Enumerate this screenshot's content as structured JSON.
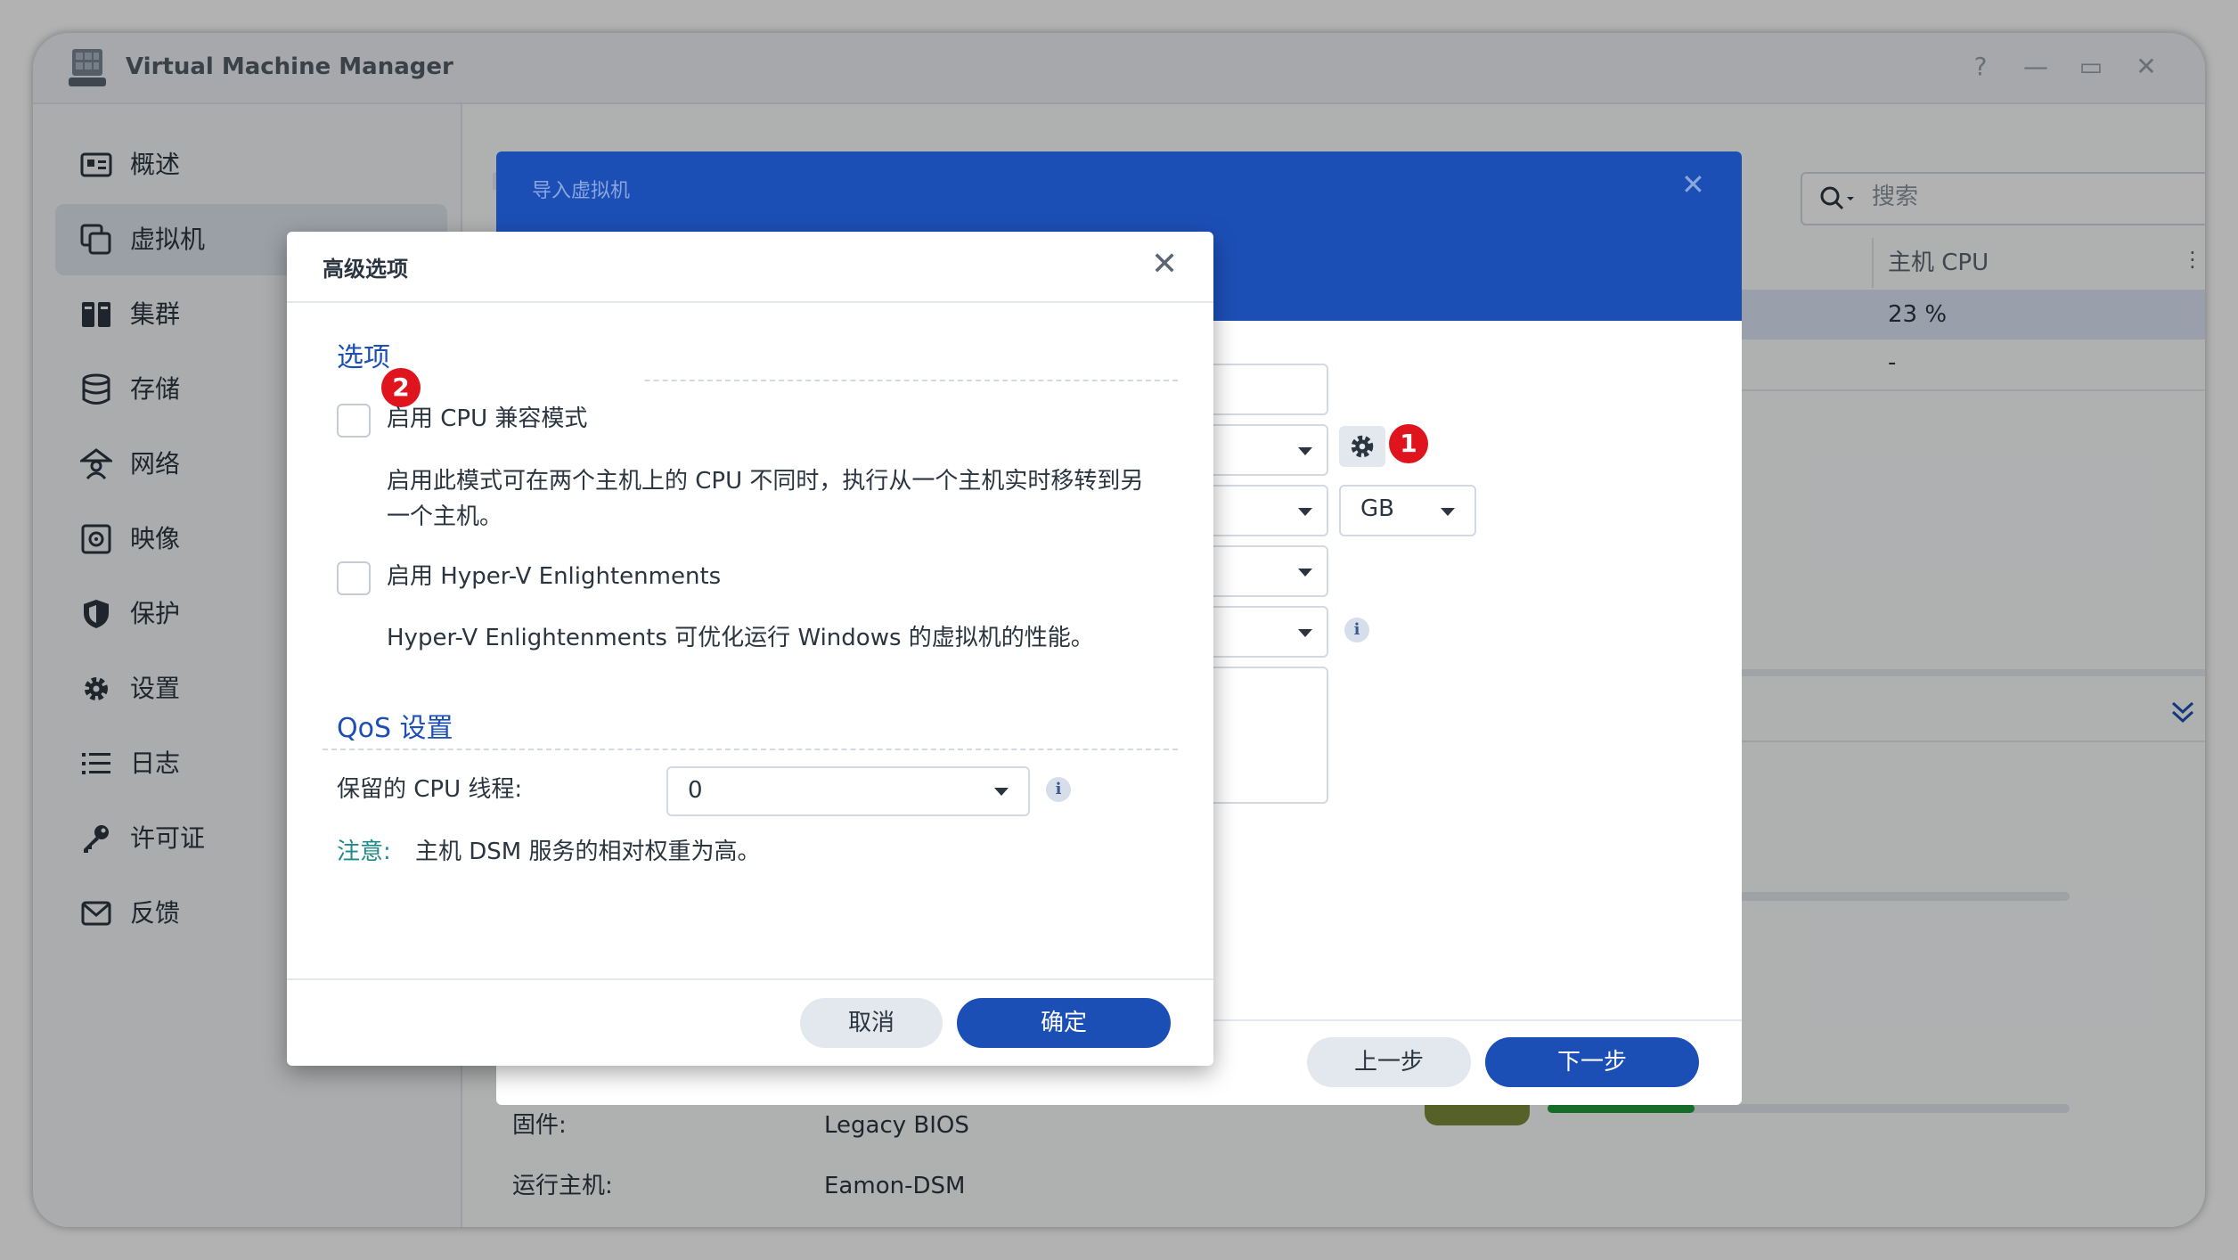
{
  "window": {
    "title": "Virtual Machine Manager",
    "controls": {
      "help": "?",
      "minimize": "—",
      "maximize": "▭",
      "close": "✕"
    }
  },
  "sidebar": {
    "items": [
      {
        "label": "概述",
        "icon": "overview-icon",
        "active": false
      },
      {
        "label": "虚拟机",
        "icon": "virtual-machine-icon",
        "active": true
      },
      {
        "label": "集群",
        "icon": "cluster-icon",
        "active": false
      },
      {
        "label": "存储",
        "icon": "storage-icon",
        "active": false
      },
      {
        "label": "网络",
        "icon": "network-icon",
        "active": false
      },
      {
        "label": "映像",
        "icon": "image-icon",
        "active": false
      },
      {
        "label": "保护",
        "icon": "shield-icon",
        "active": false
      },
      {
        "label": "设置",
        "icon": "gear-icon",
        "active": false
      },
      {
        "label": "日志",
        "icon": "log-list-icon",
        "active": false
      },
      {
        "label": "许可证",
        "icon": "key-icon",
        "active": false
      },
      {
        "label": "反馈",
        "icon": "mail-icon",
        "active": false
      }
    ]
  },
  "main": {
    "search_placeholder": "搜索",
    "table": {
      "column_cpu": "主机 CPU",
      "rows": [
        {
          "cpu": "23 %"
        },
        {
          "cpu": "-"
        }
      ]
    },
    "details": {
      "firmware_label": "固件:",
      "firmware_value": "Legacy BIOS",
      "host_label": "运行主机:",
      "host_value": "Eamon-DSM"
    }
  },
  "wizard": {
    "title": "导入虚拟机",
    "unit_select": "GB",
    "prev_button": "上一步",
    "next_button": "下一步"
  },
  "advanced_dialog": {
    "title": "高级选项",
    "options_section": "选项",
    "cpu_compat_label": "启用 CPU 兼容模式",
    "cpu_compat_desc_line1": "启用此模式可在两个主机上的 CPU 不同时，执行从一个主机实时移转到另",
    "cpu_compat_desc_line2": "一个主机。",
    "hyperv_label": "启用 Hyper-V Enlightenments",
    "hyperv_desc": "Hyper-V Enlightenments 可优化运行 Windows 的虚拟机的性能。",
    "qos_section": "QoS 设置",
    "reserved_cpu_label": "保留的 CPU 线程:",
    "reserved_cpu_value": "0",
    "note_label": "注意:",
    "note_text": "主机 DSM 服务的相对权重为高。",
    "cancel_button": "取消",
    "ok_button": "确定"
  },
  "annotations": {
    "badge1": "1",
    "badge2": "2"
  },
  "colors": {
    "accent": "#1c4fb6",
    "annotation": "#e0141c",
    "note": "#1e8a8a"
  }
}
